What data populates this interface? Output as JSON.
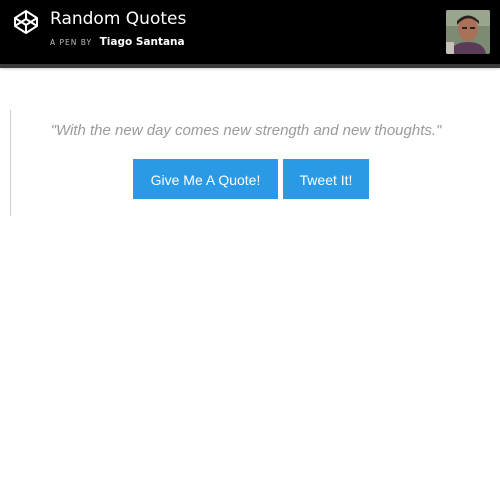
{
  "header": {
    "title": "Random Quotes",
    "byline_prefix": "A PEN BY",
    "author": "Tiago Santana",
    "logo_icon": "codepen-logo-icon",
    "avatar_icon": "user-avatar"
  },
  "quote": {
    "text": "\"With the new day comes new strength and new thoughts.\""
  },
  "buttons": {
    "new_quote": "Give Me A Quote!",
    "tweet": "Tweet It!"
  },
  "colors": {
    "header_bg": "#000000",
    "button_bg": "#2a99e6",
    "quote_text": "#9a9a9a"
  }
}
